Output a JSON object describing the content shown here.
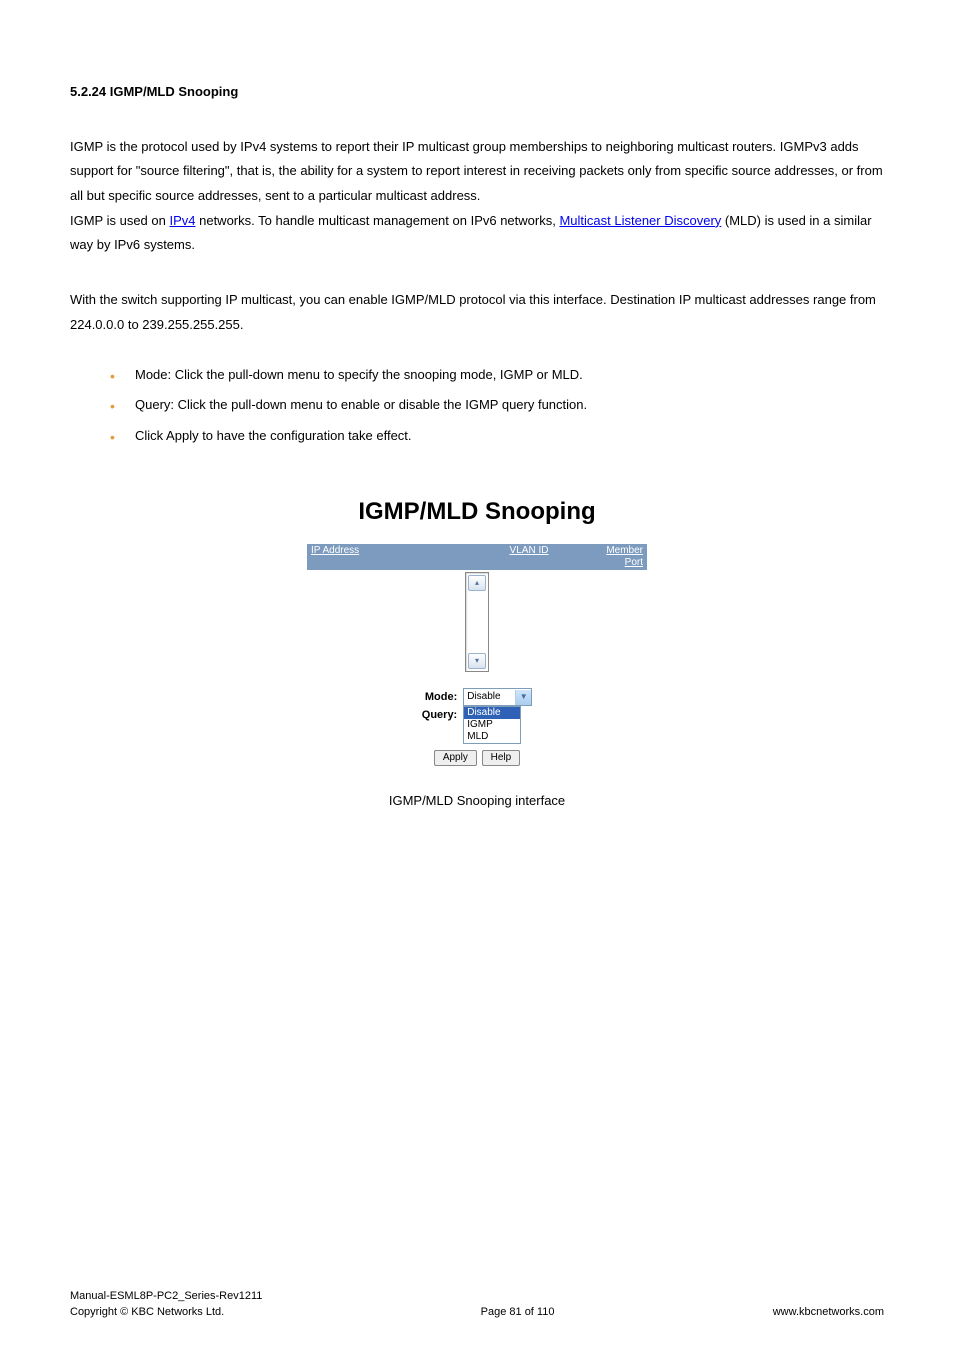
{
  "heading": "5.2.24 IGMP/MLD Snooping",
  "para1_a": "IGMP is the protocol used by IPv4 systems to report their IP multicast group memberships to neighboring multicast routers. IGMPv3 adds support for \"source filtering\", that is, the ability for a system to report interest in receiving packets only from specific source addresses, or from all but specific source addresses, sent to a particular multicast address.",
  "para1_b_pre": "IGMP is used on ",
  "para1_b_link1": "IPv4",
  "para1_b_mid": " networks. To handle multicast management on IPv6 networks, ",
  "para1_b_link2": "Multicast Listener Discovery",
  "para1_b_post": " (MLD) is used in a similar way by IPv6 systems.",
  "para2": "With the switch supporting IP multicast, you can enable IGMP/MLD protocol via this interface. Destination IP multicast addresses range from 224.0.0.0 to 239.255.255.255.",
  "bullets": [
    "Mode: Click the pull-down menu to specify the snooping mode, IGMP or MLD.",
    "Query: Click the pull-down menu to enable or disable the IGMP query function.",
    "Click Apply to have the configuration take effect."
  ],
  "figure": {
    "title": "IGMP/MLD Snooping",
    "headers": {
      "ip": "IP Address",
      "vlan": "VLAN ID",
      "port": "Member Port"
    },
    "mode_label": "Mode:",
    "mode_value": "Disable",
    "query_label": "Query:",
    "query_options": [
      "Disable",
      "IGMP",
      "MLD"
    ],
    "query_selected": "Disable",
    "apply": "Apply",
    "help": "Help",
    "caption": "IGMP/MLD Snooping interface"
  },
  "footer": {
    "line1": "Manual-ESML8P-PC2_Series-Rev1211",
    "line2": "Copyright © KBC Networks Ltd.",
    "page": "Page 81 of 110",
    "url": "www.kbcnetworks.com"
  }
}
